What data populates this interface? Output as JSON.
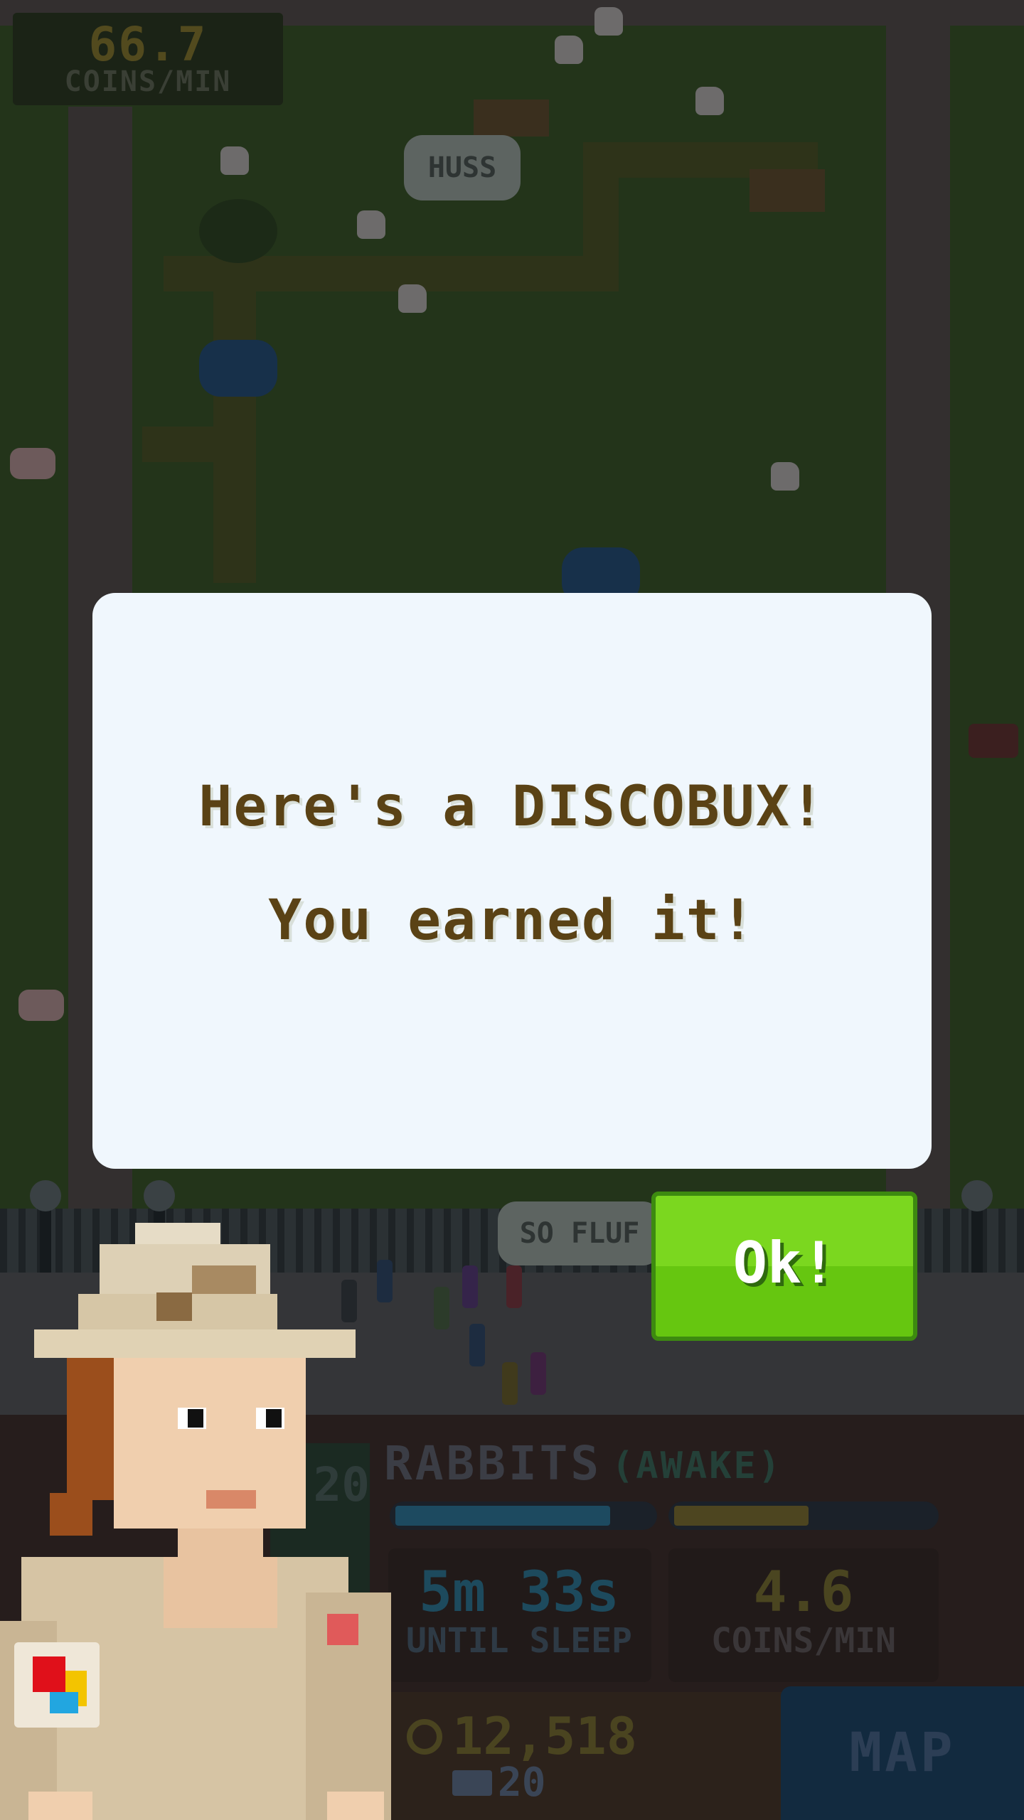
{
  "top_stat": {
    "value": "66.7",
    "unit": "COINS/MIN"
  },
  "speech_bubbles": {
    "huss": "HUSS",
    "flu": "SO FLUF"
  },
  "dialog": {
    "line1": "Here's a DISCOBUX!",
    "line2": "You earned it!",
    "ok_label": "Ok!"
  },
  "exhibit": {
    "name": "RABBITS",
    "state": "(AWAKE)",
    "count": "20",
    "energy_fraction": 0.84,
    "coin_fraction": 0.52,
    "sleep_time": "5m 33s",
    "sleep_label": "UNTIL SLEEP",
    "rate_value": "4.6",
    "rate_label": "COINS/MIN"
  },
  "wallet": {
    "coins": "12,518",
    "discobux": "20"
  },
  "nav": {
    "map_label": "MAP"
  },
  "colors": {
    "ok_button": "#6fcf17",
    "dialog_text": "#5a4215",
    "dialog_bg": "#f0f7fd"
  }
}
